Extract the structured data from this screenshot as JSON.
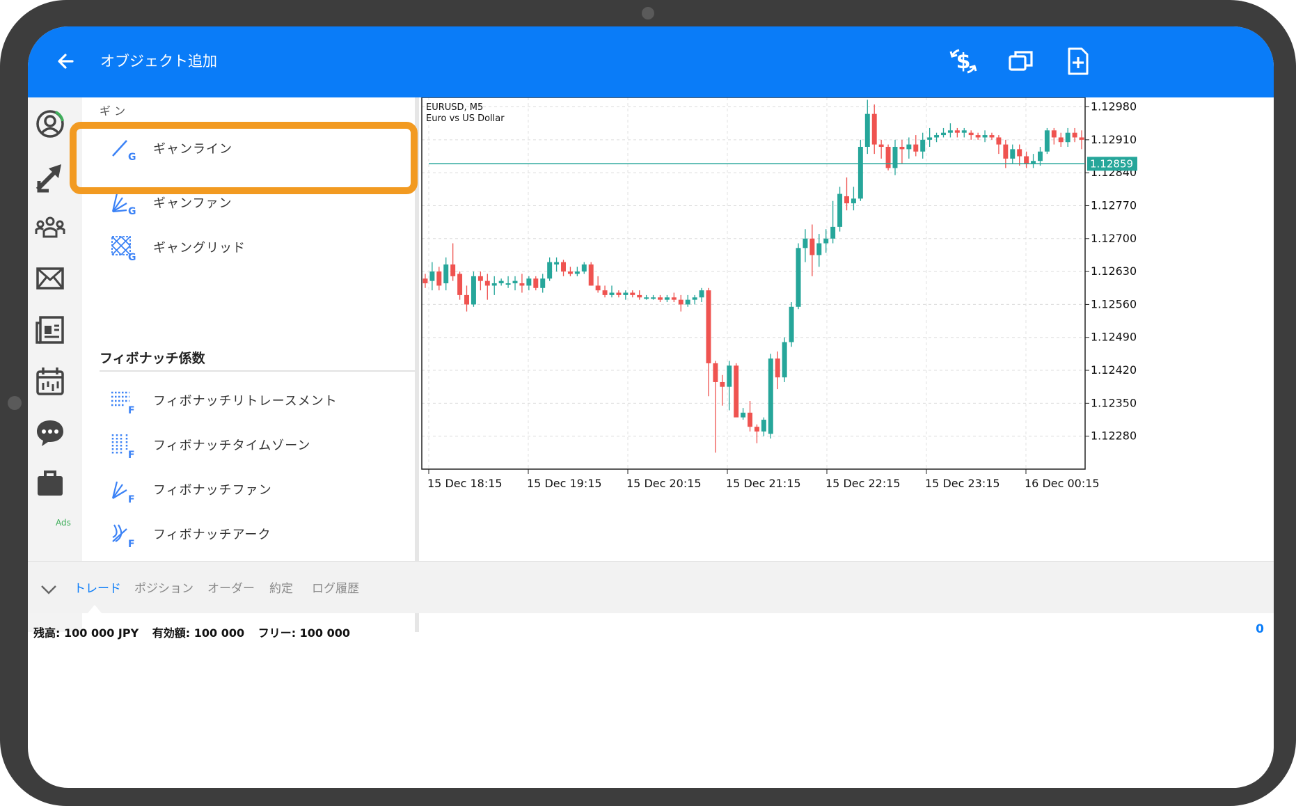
{
  "app": {
    "title": "オブジェクト追加",
    "back_icon": "arrow-left-icon",
    "actions": [
      {
        "name": "dollar-sync-icon"
      },
      {
        "name": "windows-icon"
      },
      {
        "name": "add-document-icon"
      }
    ]
  },
  "nav": {
    "items": [
      "account-icon",
      "trade-arrows-icon",
      "community-icon",
      "mail-icon",
      "news-icon",
      "calendar-icon",
      "chat-icon",
      "briefcase-icon"
    ],
    "ads_label": "Ads"
  },
  "panel": {
    "clipped_header": "ギ ン",
    "gann": [
      {
        "label": "ギャンライン",
        "icon": "gann-line-icon"
      },
      {
        "label": "ギャンファン",
        "icon": "gann-fan-icon"
      },
      {
        "label": "ギャングリッド",
        "icon": "gann-grid-icon"
      }
    ],
    "fib_section": "フィボナッチ係数",
    "fib": [
      {
        "label": "フィボナッチリトレースメント",
        "icon": "fib-retracement-icon"
      },
      {
        "label": "フィボナッチタイムゾーン",
        "icon": "fib-timezone-icon"
      },
      {
        "label": "フィボナッチファン",
        "icon": "fib-fan-icon"
      },
      {
        "label": "フィボナッチアーク",
        "icon": "fib-arc-icon"
      }
    ]
  },
  "bottom": {
    "tabs": [
      "トレード",
      "ポジション",
      "オーダー",
      "約定",
      "ログ履歴"
    ],
    "active_tab": 0,
    "balance": "残高:  100 000 JPY",
    "equity": "有効額:  100 000",
    "free": "フリー:  100 000",
    "profit": "0"
  },
  "colors": {
    "accent": "#0a7cf8",
    "bull": "#26a69a",
    "bear": "#ef5350",
    "highlight": "#f29a21"
  },
  "chart_data": {
    "type": "candlestick",
    "symbol": "EURUSD, M5",
    "description": "Euro vs US Dollar",
    "ylim": [
      1.1221,
      1.13
    ],
    "y_ticks": [
      "1.12980",
      "1.12910",
      "1.12840",
      "1.12770",
      "1.12700",
      "1.12630",
      "1.12560",
      "1.12490",
      "1.12420",
      "1.12350",
      "1.12280"
    ],
    "x_ticks": [
      "15 Dec 18:15",
      "15 Dec 19:15",
      "15 Dec 20:15",
      "15 Dec 21:15",
      "15 Dec 22:15",
      "15 Dec 23:15",
      "16 Dec 00:15"
    ],
    "current_price": "1.12859",
    "current_price_value": 1.12859,
    "ohlc": [
      [
        1.12615,
        1.12625,
        1.12595,
        1.12605
      ],
      [
        1.1261,
        1.1265,
        1.1259,
        1.1263
      ],
      [
        1.1263,
        1.1264,
        1.1259,
        1.126
      ],
      [
        1.12605,
        1.1266,
        1.1259,
        1.12645
      ],
      [
        1.12645,
        1.1269,
        1.1261,
        1.1262
      ],
      [
        1.12625,
        1.1263,
        1.1257,
        1.1258
      ],
      [
        1.1258,
        1.126,
        1.12545,
        1.1256
      ],
      [
        1.1256,
        1.1263,
        1.12555,
        1.1262
      ],
      [
        1.1262,
        1.1263,
        1.1259,
        1.1261
      ],
      [
        1.1261,
        1.12625,
        1.1257,
        1.126
      ],
      [
        1.126,
        1.1262,
        1.1258,
        1.12605
      ],
      [
        1.12605,
        1.12615,
        1.126,
        1.1261
      ],
      [
        1.12605,
        1.1262,
        1.12595,
        1.12605
      ],
      [
        1.12605,
        1.1262,
        1.1259,
        1.1261
      ],
      [
        1.12605,
        1.12625,
        1.12585,
        1.126
      ],
      [
        1.126,
        1.1262,
        1.1259,
        1.12615
      ],
      [
        1.12615,
        1.1262,
        1.1259,
        1.12595
      ],
      [
        1.12595,
        1.12625,
        1.12585,
        1.12615
      ],
      [
        1.12615,
        1.1266,
        1.1261,
        1.1265
      ],
      [
        1.12645,
        1.1266,
        1.1263,
        1.1265
      ],
      [
        1.1265,
        1.12655,
        1.1262,
        1.1263
      ],
      [
        1.1263,
        1.1264,
        1.1262,
        1.12625
      ],
      [
        1.12625,
        1.1264,
        1.1262,
        1.1263
      ],
      [
        1.1263,
        1.1265,
        1.12625,
        1.12645
      ],
      [
        1.12645,
        1.1265,
        1.126,
        1.126
      ],
      [
        1.126,
        1.1262,
        1.12585,
        1.1259
      ],
      [
        1.1259,
        1.126,
        1.12575,
        1.1258
      ],
      [
        1.1258,
        1.126,
        1.12575,
        1.12585
      ],
      [
        1.12585,
        1.1259,
        1.12575,
        1.1258
      ],
      [
        1.1258,
        1.1259,
        1.1257,
        1.12585
      ],
      [
        1.12585,
        1.1259,
        1.12575,
        1.1258
      ],
      [
        1.1258,
        1.1259,
        1.1257,
        1.12575
      ],
      [
        1.12575,
        1.1258,
        1.1257,
        1.12575
      ],
      [
        1.12575,
        1.1258,
        1.1257,
        1.12575
      ],
      [
        1.12575,
        1.1258,
        1.12565,
        1.1257
      ],
      [
        1.1257,
        1.1258,
        1.12565,
        1.12575
      ],
      [
        1.12575,
        1.12585,
        1.12565,
        1.1257
      ],
      [
        1.1257,
        1.1258,
        1.12545,
        1.1256
      ],
      [
        1.1256,
        1.1258,
        1.12555,
        1.1257
      ],
      [
        1.1257,
        1.1258,
        1.1256,
        1.12575
      ],
      [
        1.12575,
        1.12595,
        1.12565,
        1.1259
      ],
      [
        1.1259,
        1.12595,
        1.12365,
        1.12435
      ],
      [
        1.12435,
        1.1244,
        1.12245,
        1.12395
      ],
      [
        1.12395,
        1.1241,
        1.12345,
        1.12385
      ],
      [
        1.12385,
        1.1244,
        1.12335,
        1.1243
      ],
      [
        1.1243,
        1.12435,
        1.12335,
        1.1232
      ],
      [
        1.1232,
        1.1234,
        1.12315,
        1.1233
      ],
      [
        1.1233,
        1.12355,
        1.1229,
        1.123
      ],
      [
        1.123,
        1.12305,
        1.12265,
        1.1229
      ],
      [
        1.1229,
        1.1232,
        1.1228,
        1.12315
      ],
      [
        1.12285,
        1.12455,
        1.12275,
        1.12445
      ],
      [
        1.12445,
        1.1246,
        1.1238,
        1.12405
      ],
      [
        1.12405,
        1.1249,
        1.12395,
        1.1248
      ],
      [
        1.1248,
        1.12565,
        1.1247,
        1.12555
      ],
      [
        1.12555,
        1.1269,
        1.1255,
        1.1268
      ],
      [
        1.1268,
        1.1272,
        1.1265,
        1.127
      ],
      [
        1.127,
        1.1273,
        1.1262,
        1.12665
      ],
      [
        1.12665,
        1.1271,
        1.1264,
        1.1269
      ],
      [
        1.1269,
        1.1272,
        1.1267,
        1.127
      ],
      [
        1.127,
        1.1278,
        1.1269,
        1.12725
      ],
      [
        1.12725,
        1.1281,
        1.12715,
        1.12795
      ],
      [
        1.1279,
        1.1283,
        1.1276,
        1.12775
      ],
      [
        1.12775,
        1.1281,
        1.1276,
        1.12785
      ],
      [
        1.12785,
        1.1291,
        1.1278,
        1.12895
      ],
      [
        1.12895,
        1.12995,
        1.1288,
        1.12965
      ],
      [
        1.12965,
        1.12985,
        1.1288,
        1.129
      ],
      [
        1.129,
        1.1291,
        1.1287,
        1.12895
      ],
      [
        1.12895,
        1.129,
        1.12845,
        1.1285
      ],
      [
        1.1285,
        1.1291,
        1.12835,
        1.12895
      ],
      [
        1.12895,
        1.1291,
        1.1286,
        1.1289
      ],
      [
        1.1289,
        1.12915,
        1.1287,
        1.129
      ],
      [
        1.129,
        1.1292,
        1.12875,
        1.12885
      ],
      [
        1.12885,
        1.12925,
        1.1287,
        1.1291
      ],
      [
        1.1291,
        1.12935,
        1.12895,
        1.12915
      ],
      [
        1.12915,
        1.12925,
        1.12905,
        1.1292
      ],
      [
        1.1292,
        1.12935,
        1.12915,
        1.12925
      ],
      [
        1.12925,
        1.12945,
        1.12915,
        1.1293
      ],
      [
        1.1293,
        1.12935,
        1.12915,
        1.12925
      ],
      [
        1.12925,
        1.12935,
        1.12915,
        1.1293
      ],
      [
        1.12925,
        1.1293,
        1.1291,
        1.1292
      ],
      [
        1.1292,
        1.12925,
        1.1291,
        1.12915
      ],
      [
        1.12915,
        1.1293,
        1.12905,
        1.1292
      ],
      [
        1.1292,
        1.12925,
        1.1291,
        1.12915
      ],
      [
        1.12915,
        1.1292,
        1.1288,
        1.129
      ],
      [
        1.129,
        1.1291,
        1.1285,
        1.1287
      ],
      [
        1.1287,
        1.129,
        1.1286,
        1.1289
      ],
      [
        1.1289,
        1.129,
        1.12855,
        1.12875
      ],
      [
        1.12875,
        1.12885,
        1.1285,
        1.1286
      ],
      [
        1.1286,
        1.1288,
        1.1285,
        1.12865
      ],
      [
        1.12865,
        1.12895,
        1.12855,
        1.12885
      ],
      [
        1.12885,
        1.12935,
        1.1288,
        1.1293
      ],
      [
        1.1293,
        1.12935,
        1.129,
        1.12915
      ],
      [
        1.12915,
        1.12925,
        1.12895,
        1.12905
      ],
      [
        1.12905,
        1.12935,
        1.12895,
        1.12925
      ],
      [
        1.12925,
        1.12935,
        1.12905,
        1.12915
      ],
      [
        1.12915,
        1.1293,
        1.1289,
        1.1291
      ]
    ]
  }
}
